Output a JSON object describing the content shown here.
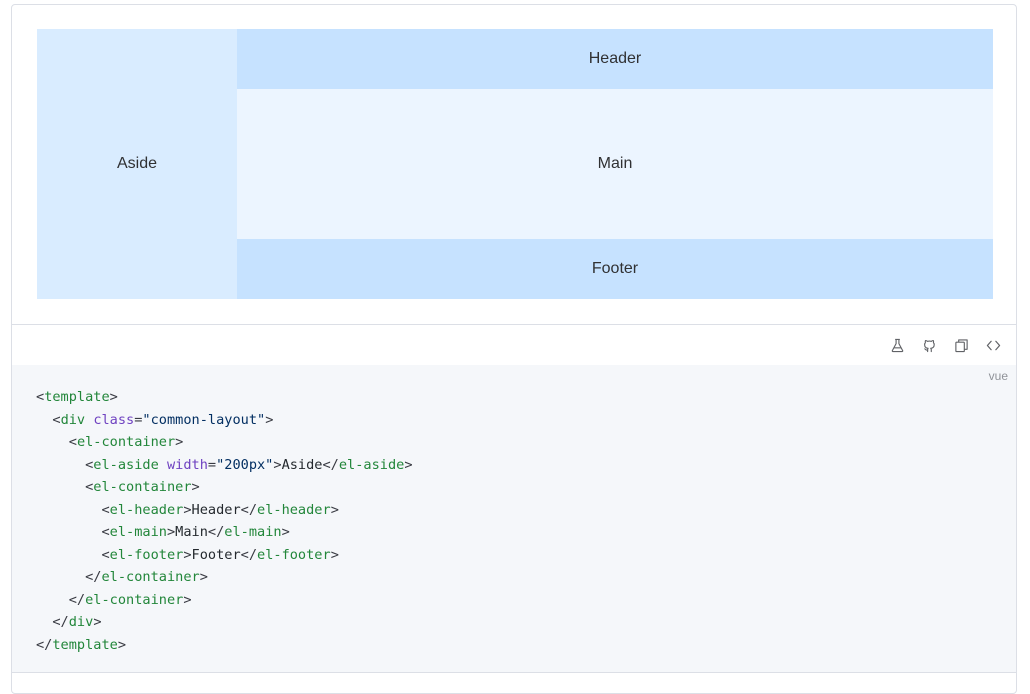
{
  "preview": {
    "aside": "Aside",
    "header": "Header",
    "main": "Main",
    "footer": "Footer",
    "colors": {
      "aside_bg": "#d9ecff",
      "header_footer_bg": "#c6e2ff",
      "main_bg": "#ecf5ff"
    }
  },
  "toolbar": {
    "icons": [
      "flask-icon",
      "github-icon",
      "copy-icon",
      "code-icon"
    ]
  },
  "code": {
    "language": "vue",
    "lines": [
      [
        [
          "p",
          "<"
        ],
        [
          "t",
          "template"
        ],
        [
          "p",
          ">"
        ]
      ],
      [
        [
          "s",
          "  "
        ],
        [
          "p",
          "<"
        ],
        [
          "t",
          "div"
        ],
        [
          "s",
          " "
        ],
        [
          "a",
          "class"
        ],
        [
          "p",
          "="
        ],
        [
          "v",
          "\"common-layout\""
        ],
        [
          "p",
          ">"
        ]
      ],
      [
        [
          "s",
          "    "
        ],
        [
          "p",
          "<"
        ],
        [
          "t",
          "el-container"
        ],
        [
          "p",
          ">"
        ]
      ],
      [
        [
          "s",
          "      "
        ],
        [
          "p",
          "<"
        ],
        [
          "t",
          "el-aside"
        ],
        [
          "s",
          " "
        ],
        [
          "a",
          "width"
        ],
        [
          "p",
          "="
        ],
        [
          "v",
          "\"200px\""
        ],
        [
          "p",
          ">"
        ],
        [
          "x",
          "Aside"
        ],
        [
          "p",
          "</"
        ],
        [
          "t",
          "el-aside"
        ],
        [
          "p",
          ">"
        ]
      ],
      [
        [
          "s",
          "      "
        ],
        [
          "p",
          "<"
        ],
        [
          "t",
          "el-container"
        ],
        [
          "p",
          ">"
        ]
      ],
      [
        [
          "s",
          "        "
        ],
        [
          "p",
          "<"
        ],
        [
          "t",
          "el-header"
        ],
        [
          "p",
          ">"
        ],
        [
          "x",
          "Header"
        ],
        [
          "p",
          "</"
        ],
        [
          "t",
          "el-header"
        ],
        [
          "p",
          ">"
        ]
      ],
      [
        [
          "s",
          "        "
        ],
        [
          "p",
          "<"
        ],
        [
          "t",
          "el-main"
        ],
        [
          "p",
          ">"
        ],
        [
          "x",
          "Main"
        ],
        [
          "p",
          "</"
        ],
        [
          "t",
          "el-main"
        ],
        [
          "p",
          ">"
        ]
      ],
      [
        [
          "s",
          "        "
        ],
        [
          "p",
          "<"
        ],
        [
          "t",
          "el-footer"
        ],
        [
          "p",
          ">"
        ],
        [
          "x",
          "Footer"
        ],
        [
          "p",
          "</"
        ],
        [
          "t",
          "el-footer"
        ],
        [
          "p",
          ">"
        ]
      ],
      [
        [
          "s",
          "      "
        ],
        [
          "p",
          "</"
        ],
        [
          "t",
          "el-container"
        ],
        [
          "p",
          ">"
        ]
      ],
      [
        [
          "s",
          "    "
        ],
        [
          "p",
          "</"
        ],
        [
          "t",
          "el-container"
        ],
        [
          "p",
          ">"
        ]
      ],
      [
        [
          "s",
          "  "
        ],
        [
          "p",
          "</"
        ],
        [
          "t",
          "div"
        ],
        [
          "p",
          ">"
        ]
      ],
      [
        [
          "p",
          "</"
        ],
        [
          "t",
          "template"
        ],
        [
          "p",
          ">"
        ]
      ]
    ]
  }
}
